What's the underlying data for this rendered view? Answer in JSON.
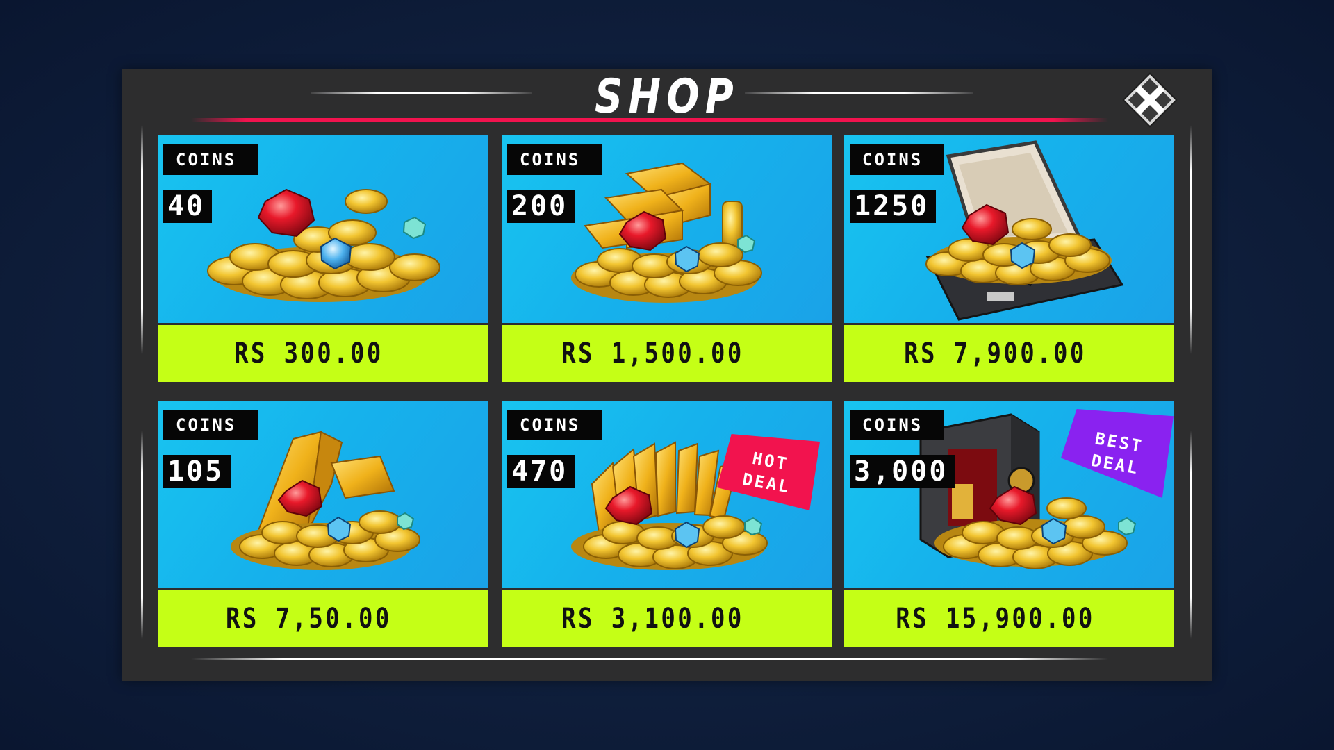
{
  "shop": {
    "title": "SHOP",
    "close_icon": "close-icon",
    "colors": {
      "background": "#10213f",
      "panel": "#2d2d2e",
      "accent": "#f2134e",
      "card_sky": "#16b2ec",
      "price_bar": "#c5ff16",
      "hot_badge": "#f2134e",
      "best_badge": "#8a22f0"
    },
    "items": [
      {
        "coins_label": "COINS",
        "amount": "40",
        "price": "RS 300.00",
        "badge": ""
      },
      {
        "coins_label": "COINS",
        "amount": "200",
        "price": "RS 1,500.00",
        "badge": ""
      },
      {
        "coins_label": "COINS",
        "amount": "1250",
        "price": "RS 7,900.00",
        "badge": ""
      },
      {
        "coins_label": "COINS",
        "amount": "105",
        "price": "RS 7,50.00",
        "badge": ""
      },
      {
        "coins_label": "COINS",
        "amount": "470",
        "price": "RS 3,100.00",
        "badge": "HOT DEAL"
      },
      {
        "coins_label": "COINS",
        "amount": "3,000",
        "price": "RS 15,900.00",
        "badge": "BEST DEAL"
      }
    ]
  }
}
